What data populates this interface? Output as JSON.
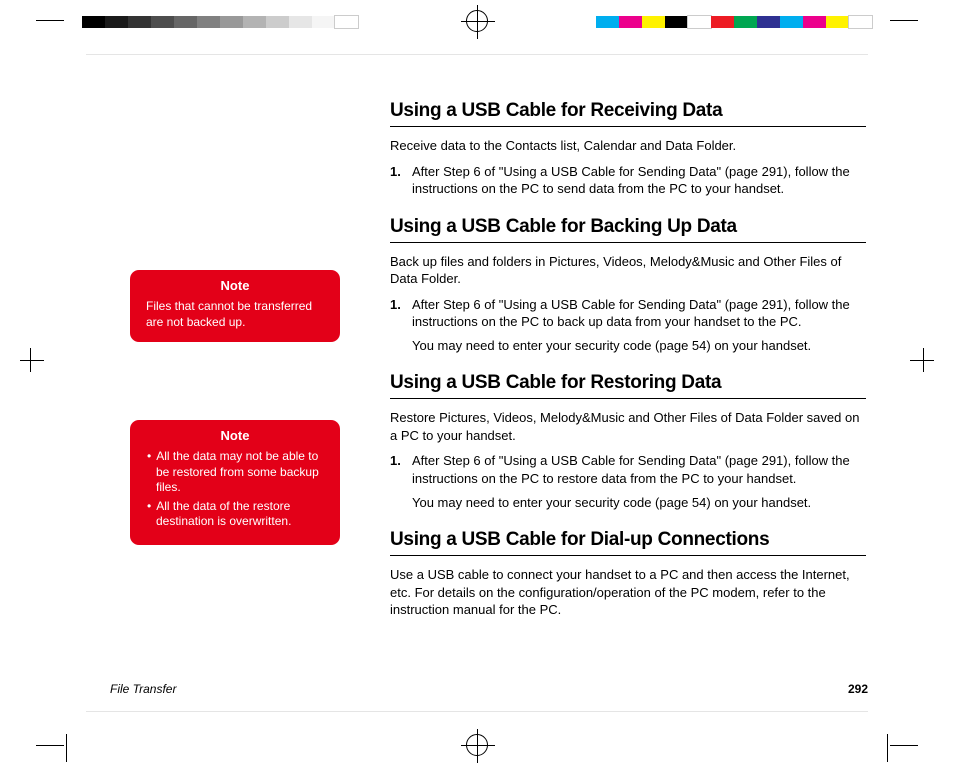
{
  "sections": {
    "receiving": {
      "heading": "Using a USB Cable for Receiving Data",
      "intro": "Receive data to the Contacts list, Calendar and Data Folder.",
      "step1": "After Step 6 of \"Using a USB Cable for Sending Data\" (page 291), follow the instructions on the PC to send data from the PC to your handset."
    },
    "backup": {
      "heading": "Using a USB Cable for Backing Up Data",
      "intro": "Back up files and folders in Pictures, Videos, Melody&Music and Other Files of Data Folder.",
      "step1": "After Step 6 of \"Using a USB Cable for Sending Data\" (page 291), follow the instructions on the PC to back up data from your handset to the PC.",
      "sub1": "You may need to enter your security code (page 54) on your handset."
    },
    "restoring": {
      "heading": "Using a USB Cable for Restoring Data",
      "intro": "Restore Pictures, Videos, Melody&Music and Other Files of Data Folder saved on a PC to your handset.",
      "step1": "After Step 6 of \"Using a USB Cable for Sending Data\" (page 291), follow the instructions on the PC to restore data from the PC to your handset.",
      "sub1": "You may need to enter your security code (page 54) on your handset."
    },
    "dialup": {
      "heading": "Using a USB Cable for Dial-up Connections",
      "intro": "Use a USB cable to connect your handset to a PC and then access the Internet, etc. For details on the configuration/operation of the PC modem, refer to the instruction manual for the PC."
    }
  },
  "notes": {
    "label": "Note",
    "note1": "Files that cannot be transferred are not backed up.",
    "note2_item1": "All the data may not be able to be restored from some backup files.",
    "note2_item2": "All the data of the restore destination is overwritten."
  },
  "step_labels": {
    "one": "1."
  },
  "footer": {
    "section": "File Transfer",
    "page": "292"
  },
  "colors": {
    "greys": [
      "#000000",
      "#1a1a1a",
      "#333333",
      "#4d4d4d",
      "#666666",
      "#808080",
      "#999999",
      "#b3b3b3",
      "#cccccc",
      "#e6e6e6",
      "#f5f5f5",
      "#ffffff"
    ],
    "process": [
      "#00aeef",
      "#ec008c",
      "#fff200",
      "#000000",
      "#ffffff",
      "#ed1c24",
      "#00a651",
      "#2e3192",
      "#00aeef",
      "#ec008c",
      "#fff200",
      "#ffffff"
    ]
  }
}
